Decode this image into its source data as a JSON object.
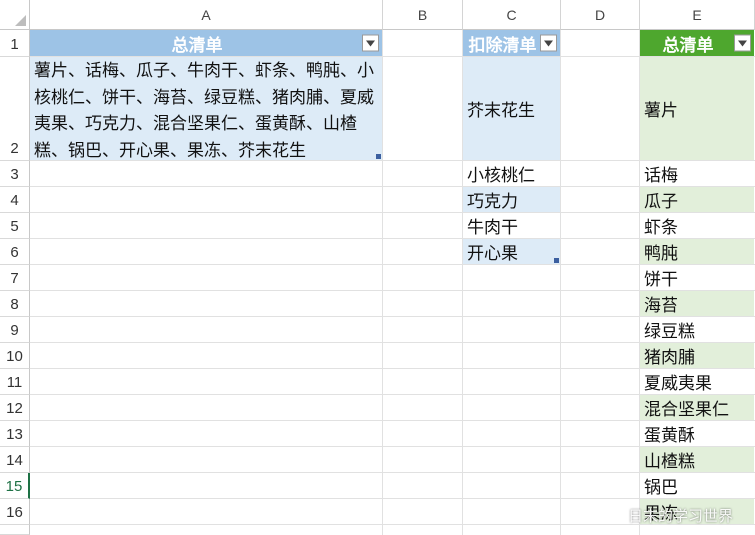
{
  "columns": [
    "A",
    "B",
    "C",
    "D",
    "E"
  ],
  "rows": [
    "1",
    "2",
    "3",
    "4",
    "5",
    "6",
    "7",
    "8",
    "9",
    "10",
    "11",
    "12",
    "13",
    "14",
    "15",
    "16"
  ],
  "selected_row": "15",
  "total_list": {
    "header": "总清单",
    "content": "薯片、话梅、瓜子、牛肉干、虾条、鸭肫、小核桃仁、饼干、海苔、绿豆糕、猪肉脯、夏威夷果、巧克力、混合坚果仁、蛋黄酥、山楂糕、锅巴、开心果、果冻、芥末花生",
    "header_color": "#9dc3e6",
    "fill_color": "#ddebf7"
  },
  "deduct_list": {
    "header": "扣除清单",
    "items": [
      "芥末花生",
      "小核桃仁",
      "巧克力",
      "牛肉干",
      "开心果"
    ],
    "header_color": "#9dc3e6",
    "band_color": "#ddebf7"
  },
  "result_list": {
    "header": "总清单",
    "items": [
      "薯片",
      "话梅",
      "瓜子",
      "虾条",
      "鸭肫",
      "饼干",
      "海苔",
      "绿豆糕",
      "猪肉脯",
      "夏威夷果",
      "混合坚果仁",
      "蛋黄酥",
      "山楂糕",
      "锅巴",
      "果冻"
    ],
    "header_color": "#4ea72e",
    "band_color": "#e2efda"
  },
  "watermark": "日末的学习世界"
}
